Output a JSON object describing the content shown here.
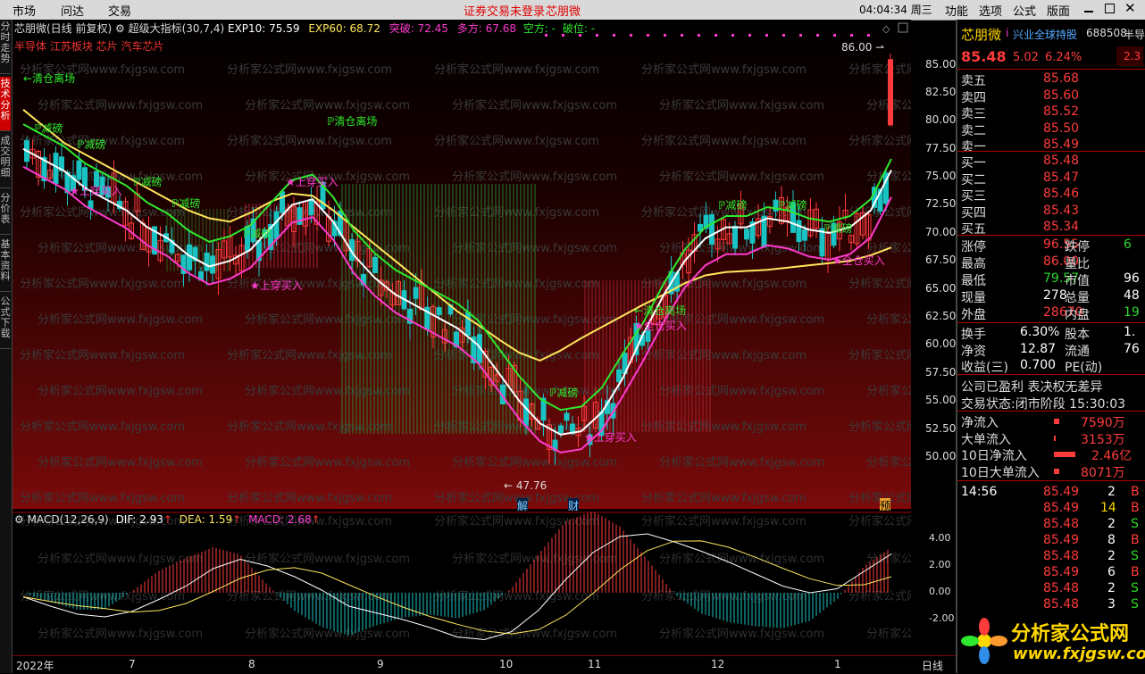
{
  "menu": {
    "items": [
      "市场",
      "问达",
      "交易"
    ],
    "warning": "证券交易未登录",
    "stock_link": "芯朋微",
    "time": "04:04:34 周三",
    "right_items": [
      "功能",
      "选项",
      "公式",
      "版面"
    ]
  },
  "left_tabs": [
    "分时走势",
    "技术分析",
    "成交明细",
    "分价表",
    "基本资料",
    "公式下载"
  ],
  "chart": {
    "head": {
      "name": "芯朋微(日线 前复权)",
      "indicator": "超级大指标(30,7,4)",
      "exp10": "EXP10: 75.59",
      "exp60": "EXP60: 68.72",
      "tupo": "突破: 72.45",
      "duofang": "多方: 67.68",
      "kongfang": "空方: -",
      "poxian": "破位: -"
    },
    "concepts": "半导体 江苏板块 芯片 汽车芯片",
    "y_ticks": [
      "85.00",
      "82.50",
      "80.00",
      "77.50",
      "75.00",
      "72.50",
      "70.00",
      "67.50",
      "65.00",
      "62.50",
      "60.00",
      "57.50",
      "55.00",
      "52.50",
      "50.00"
    ],
    "high_label": "86.00",
    "low_label": "47.76",
    "event_labels": [
      "解",
      "财",
      "预"
    ],
    "signals": {
      "clear": "清仓离场",
      "reduce": "减磅",
      "buy": "上穿买入",
      "clear2": "清仓离场",
      "full": "全仓买入"
    },
    "watermark": "分析家公式网www.fxjgsw.com"
  },
  "chart_data": {
    "type": "line",
    "series": [
      {
        "name": "EXP10",
        "values": [
          77.5,
          76.5,
          75.5,
          74,
          73,
          72,
          70.5,
          69.5,
          68,
          67,
          67.5,
          68.5,
          70.5,
          72.5,
          73,
          71,
          68,
          66,
          64.5,
          63.5,
          62.5,
          61.5,
          60,
          57.5,
          55,
          53,
          52,
          52.3,
          54,
          57,
          61,
          64.5,
          67.5,
          69.5,
          70.5,
          70.5,
          71.3,
          71,
          70.3,
          70,
          70.5,
          72,
          75.6
        ]
      },
      {
        "name": "EXP60",
        "values": [
          81,
          79.5,
          78,
          77,
          76,
          75,
          74,
          73,
          72,
          71.3,
          71,
          71.8,
          72.8,
          73.5,
          73.3,
          72,
          70.5,
          69,
          67.5,
          66,
          64.5,
          63,
          61.8,
          60.5,
          59.3,
          58.6,
          59.5,
          60.6,
          61.6,
          62.6,
          63.6,
          64.5,
          65.5,
          66.2,
          66.5,
          66.6,
          66.7,
          66.9,
          67.1,
          67.3,
          67.5,
          68,
          68.7
        ]
      }
    ],
    "ylim": [
      47.76,
      86.0
    ]
  },
  "macd": {
    "head": "MACD(12,26,9)",
    "dif": "DIF: 2.93",
    "dea": "DEA: 1.59",
    "macd": "MACD: 2.68",
    "y_ticks": [
      "4.00",
      "2.00",
      "0.00",
      "-2.00"
    ]
  },
  "macd_data": {
    "dif": [
      -0.3,
      -1.0,
      -1.6,
      -1.8,
      -1.4,
      -0.5,
      0.5,
      1.8,
      2.5,
      2.0,
      1.2,
      0.2,
      -1.0,
      -1.5,
      -2.0,
      -2.6,
      -3.3,
      -3.5,
      -2.9,
      -1.3,
      1.0,
      3.0,
      4.2,
      4.4,
      3.8,
      3.1,
      2.3,
      1.4,
      0.5,
      0.0,
      0.3,
      1.6,
      2.9
    ]
  },
  "x_labels": [
    "2022年",
    "7",
    "8",
    "9",
    "10",
    "11",
    "12",
    "1"
  ],
  "x_right": "日线",
  "quote": {
    "name": "芯朋微",
    "tag": "兴业全球持股",
    "code": "688508",
    "edge": "半导",
    "price": "85.48",
    "change": "5.02",
    "pct": "6.24%",
    "side_pct": "2.3",
    "asks": [
      {
        "label": "卖五",
        "price": "85.68"
      },
      {
        "label": "卖四",
        "price": "85.60"
      },
      {
        "label": "卖三",
        "price": "85.52"
      },
      {
        "label": "卖二",
        "price": "85.50"
      },
      {
        "label": "卖一",
        "price": "85.49"
      }
    ],
    "bids": [
      {
        "label": "买一",
        "price": "85.48"
      },
      {
        "label": "买二",
        "price": "85.47"
      },
      {
        "label": "买三",
        "price": "85.46"
      },
      {
        "label": "买四",
        "price": "85.43"
      },
      {
        "label": "买五",
        "price": "85.34"
      }
    ],
    "stats": [
      {
        "l1": "涨停",
        "v1": "96.55",
        "l2": "跌停",
        "v2": "6"
      },
      {
        "l1": "最高",
        "v1": "86.00",
        "l2": "量比",
        "v2": ""
      },
      {
        "l1": "最低",
        "v1": "79.57",
        "l2": "市值",
        "v2": "96"
      },
      {
        "l1": "现量",
        "v1": "278",
        "l2": "总量",
        "v2": "48"
      },
      {
        "l1": "外盘",
        "v1": "28670",
        "l2": "内盘",
        "v2": "19"
      }
    ],
    "stats2": [
      {
        "l1": "换手",
        "v1": "6.30%",
        "l2": "股本",
        "v2": "1."
      },
      {
        "l1": "净资",
        "v1": "12.87",
        "l2": "流通",
        "v2": "76"
      },
      {
        "l1": "收益(三)",
        "v1": "0.700",
        "l2": "PE(动)",
        "v2": ""
      }
    ],
    "notice": "公司已盈利 表决权无差异",
    "status_label": "交易状态:",
    "status_value": "闭市阶段",
    "status_time": "15:30:03",
    "flows": [
      {
        "label": "净流入",
        "value": "7590万"
      },
      {
        "label": "大单流入",
        "value": "3153万"
      },
      {
        "label": "10日净流入",
        "value": "2.46亿"
      },
      {
        "label": "10日大单流入",
        "value": "8071万"
      }
    ],
    "ticks": [
      {
        "time": "14:56",
        "price": "85.49",
        "vol": "2",
        "bs": "B"
      },
      {
        "time": "",
        "price": "85.49",
        "vol": "14",
        "bs": "B"
      },
      {
        "time": "",
        "price": "85.48",
        "vol": "2",
        "bs": "S"
      },
      {
        "time": "",
        "price": "85.49",
        "vol": "8",
        "bs": "B"
      },
      {
        "time": "",
        "price": "85.48",
        "vol": "2",
        "bs": "S"
      },
      {
        "time": "",
        "price": "85.49",
        "vol": "6",
        "bs": "B"
      },
      {
        "time": "",
        "price": "85.48",
        "vol": "2",
        "bs": "S"
      },
      {
        "time": "",
        "price": "85.48",
        "vol": "3",
        "bs": "S"
      },
      {
        "time": "",
        "price": "85.49",
        "vol": "6",
        "bs": "B"
      }
    ]
  },
  "logo": {
    "text": "分析家公式网",
    "url": "www.fxjgsw.com"
  },
  "colors": {
    "up": "#ff3b3b",
    "down": "#19c3c3",
    "exp10": "#ffffff",
    "exp60": "#ffe65c",
    "bull": "#ff3bd0",
    "bear": "#2ee82e"
  }
}
